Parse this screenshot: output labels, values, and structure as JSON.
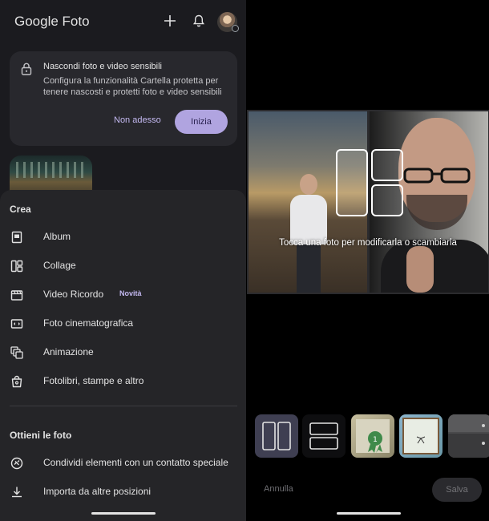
{
  "app": {
    "title": "Google Foto"
  },
  "topbar": {
    "add_icon": "plus-icon",
    "notifications_icon": "bell-icon",
    "avatar_icon": "account-avatar"
  },
  "promo_card": {
    "title": "Nascondi foto e video sensibili",
    "description": "Configura la funzionalità Cartella protetta per tenere nascosti e protetti foto e video sensibili",
    "dismiss_label": "Non adesso",
    "start_label": "Inizia",
    "accent": "#b0a4e0"
  },
  "create_sheet": {
    "title": "Crea",
    "items": [
      {
        "label": "Album",
        "icon": "album-icon"
      },
      {
        "label": "Collage",
        "icon": "collage-icon"
      },
      {
        "label": "Video Ricordo",
        "icon": "video-icon",
        "badge": "Novità"
      },
      {
        "label": "Foto cinematografica",
        "icon": "cinematic-icon"
      },
      {
        "label": "Animazione",
        "icon": "animation-icon"
      },
      {
        "label": "Fotolibri, stampe e altro",
        "icon": "shop-bag-icon"
      }
    ],
    "get_photos_title": "Ottieni le foto",
    "get_photos_items": [
      {
        "label": "Condividi elementi con un contatto speciale",
        "icon": "share-link-icon"
      },
      {
        "label": "Importa da altre posizioni",
        "icon": "download-icon"
      }
    ]
  },
  "collage_editor": {
    "hint": "Tocca una foto per modificarla o scambiarla",
    "layouts": [
      "two-columns",
      "two-rows",
      "sticker-frame",
      "blue-frame",
      "split-gray"
    ],
    "selected_layout": "two-columns",
    "cancel_label": "Annulla",
    "save_label": "Salva"
  }
}
